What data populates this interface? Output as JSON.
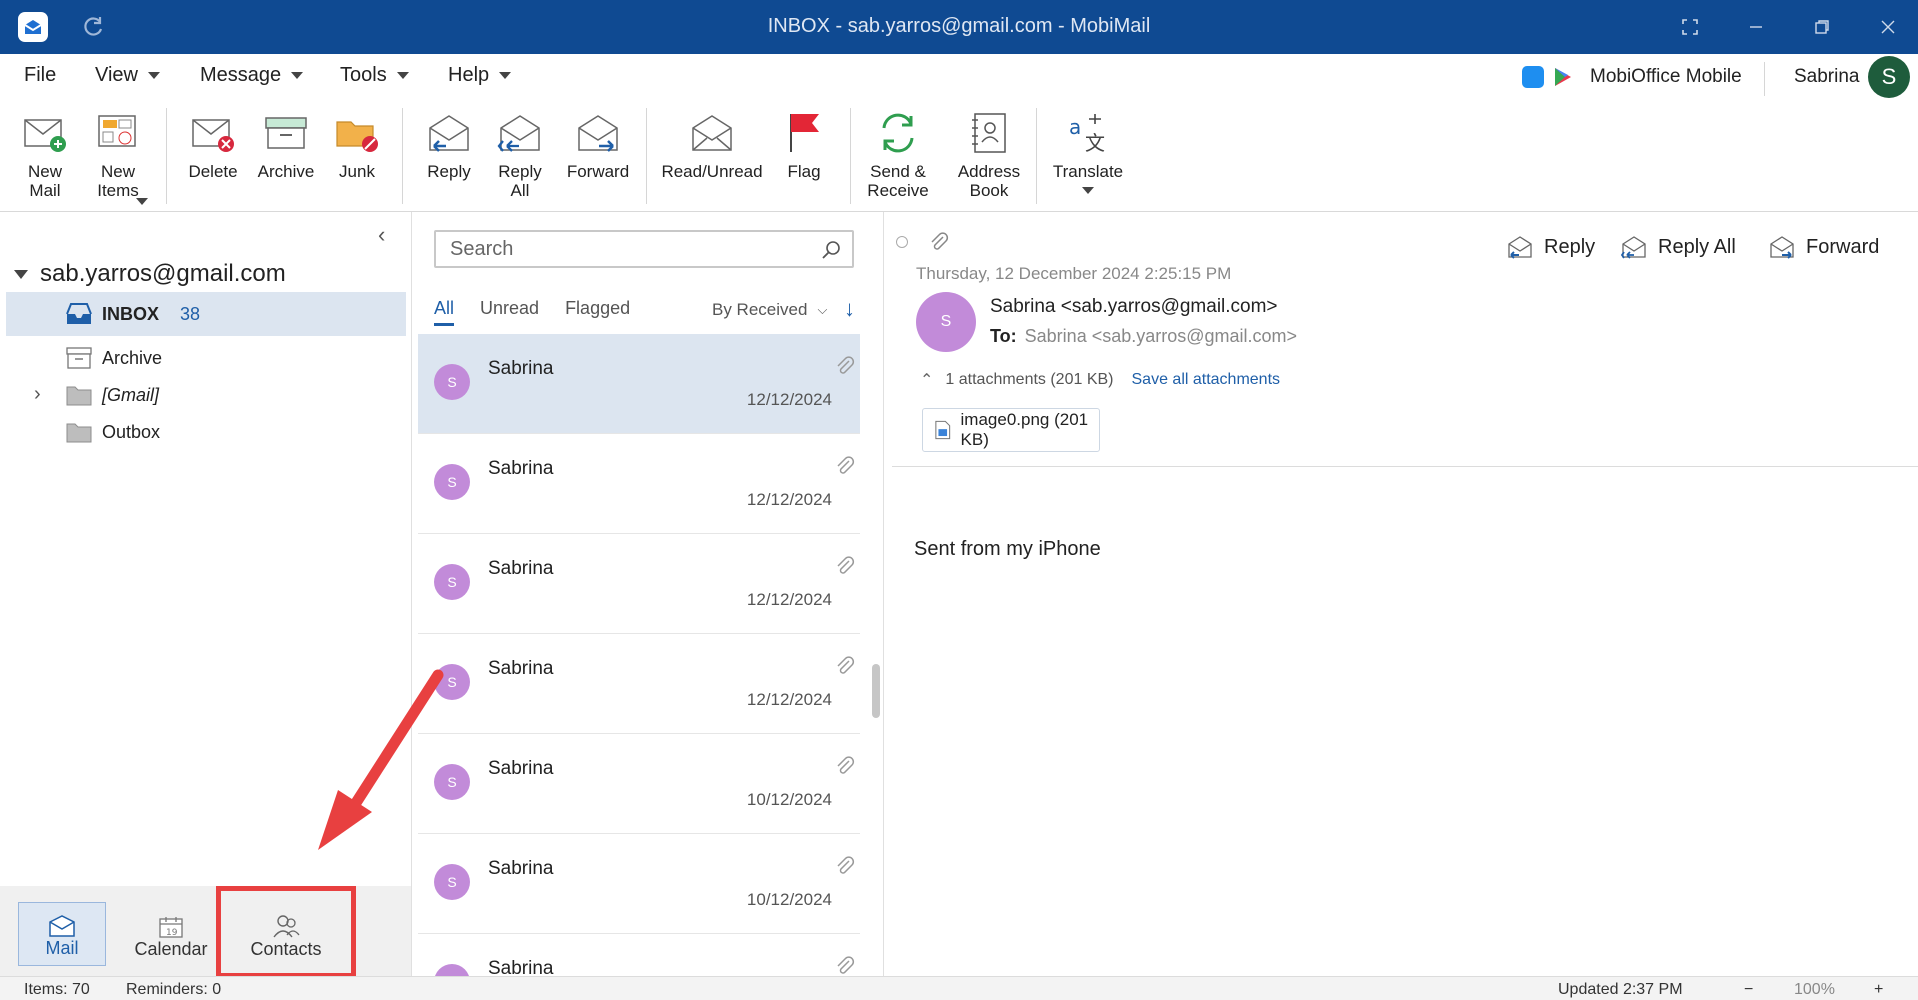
{
  "window": {
    "title": "INBOX - sab.yarros@gmail.com - MobiMail"
  },
  "menu": {
    "items": [
      "File",
      "View",
      "Message",
      "Tools",
      "Help"
    ],
    "mobioffice_label": "MobiOffice Mobile",
    "user_name": "Sabrina",
    "user_initial": "S"
  },
  "ribbon": {
    "new_mail": "New\nMail",
    "new_items": "New\nItems",
    "delete": "Delete",
    "archive": "Archive",
    "junk": "Junk",
    "reply": "Reply",
    "reply_all": "Reply\nAll",
    "forward": "Forward",
    "read_unread": "Read/Unread",
    "flag": "Flag",
    "send_receive": "Send &\nReceive",
    "address_book": "Address\nBook",
    "translate": "Translate"
  },
  "folders": {
    "account": "sab.yarros@gmail.com",
    "items": [
      {
        "name": "INBOX",
        "count": "38"
      },
      {
        "name": "Archive",
        "count": ""
      },
      {
        "name": "[Gmail]",
        "count": ""
      },
      {
        "name": "Outbox",
        "count": ""
      }
    ]
  },
  "bottomnav": {
    "mail": "Mail",
    "calendar": "Calendar",
    "contacts": "Contacts"
  },
  "msglist": {
    "search_placeholder": "Search",
    "filters": [
      "All",
      "Unread",
      "Flagged"
    ],
    "sort_label": "By Received",
    "messages": [
      {
        "initial": "S",
        "sender": "Sabrina",
        "date": "12/12/2024"
      },
      {
        "initial": "S",
        "sender": "Sabrina",
        "date": "12/12/2024"
      },
      {
        "initial": "S",
        "sender": "Sabrina",
        "date": "12/12/2024"
      },
      {
        "initial": "S",
        "sender": "Sabrina",
        "date": "12/12/2024"
      },
      {
        "initial": "S",
        "sender": "Sabrina",
        "date": "10/12/2024"
      },
      {
        "initial": "S",
        "sender": "Sabrina",
        "date": "10/12/2024"
      },
      {
        "initial": "S",
        "sender": "Sabrina",
        "date": ""
      }
    ]
  },
  "reading": {
    "date": "Thursday, 12 December 2024 2:25:15 PM",
    "initial": "S",
    "from": "Sabrina <sab.yarros@gmail.com>",
    "to_label": "To:",
    "to": "Sabrina <sab.yarros@gmail.com>",
    "reply": "Reply",
    "reply_all": "Reply All",
    "forward": "Forward",
    "attachments_summary": "1 attachments (201 KB)",
    "save_all": "Save all attachments",
    "attachment_name": "image0.png (201 KB)",
    "body": "Sent from my iPhone"
  },
  "status": {
    "items": "Items: 70",
    "reminders": "Reminders: 0",
    "updated": "Updated 2:37 PM",
    "zoom_minus": "−",
    "zoom": "100%",
    "zoom_plus": "+"
  },
  "colors": {
    "titlebar": "#0f4a92",
    "accent": "#1f5fa8",
    "selection": "#dce5f0",
    "avatar": "#c28bd9",
    "highlight": "#e84040"
  }
}
